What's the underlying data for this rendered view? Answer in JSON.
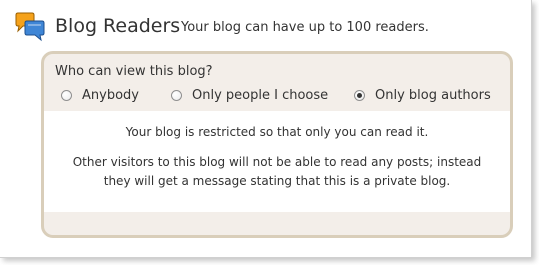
{
  "header": {
    "icon": "chat-bubbles-icon",
    "title": "Blog Readers",
    "subtitle": "Your blog can have up to 100 readers."
  },
  "permissions": {
    "heading": "Who can view this blog?",
    "options": [
      {
        "label": "Anybody",
        "checked": false
      },
      {
        "label": "Only people I choose",
        "checked": false
      },
      {
        "label": "Only blog authors",
        "checked": true
      }
    ],
    "message": "Your blog is restricted so that only you can read it.",
    "details_line1": "Other visitors to this blog will not be able to read any posts; instead",
    "details_line2": "they will get a message stating that this is a private blog."
  },
  "colors": {
    "box_border": "#d9ceba",
    "box_background": "#f3eee9",
    "icon_orange": "#f5a21b",
    "icon_blue": "#3f86d6"
  }
}
